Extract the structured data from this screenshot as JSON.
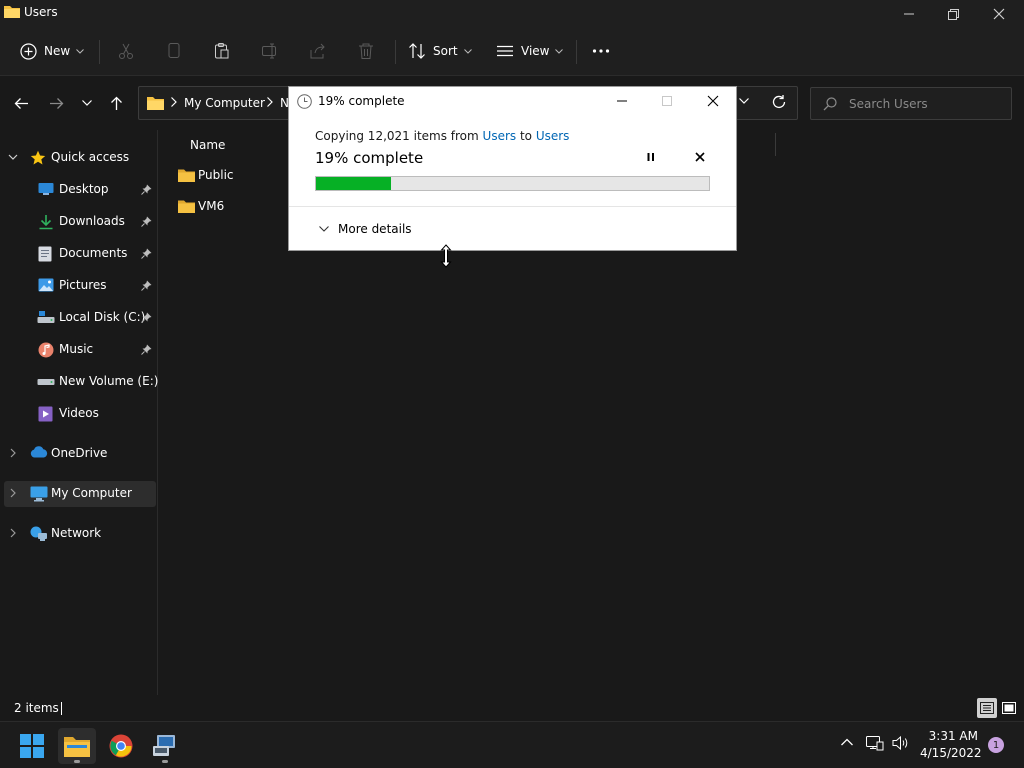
{
  "window": {
    "title": "Users"
  },
  "toolbar": {
    "new_label": "New",
    "sort_label": "Sort",
    "view_label": "View"
  },
  "address": {
    "crumb1": "My Computer",
    "crumb2": "N"
  },
  "search": {
    "placeholder": "Search Users"
  },
  "sidebar": {
    "items": [
      {
        "label": "Quick access",
        "icon": "star-icon"
      },
      {
        "label": "Desktop",
        "icon": "desktop-icon"
      },
      {
        "label": "Downloads",
        "icon": "download-icon"
      },
      {
        "label": "Documents",
        "icon": "document-icon"
      },
      {
        "label": "Pictures",
        "icon": "picture-icon"
      },
      {
        "label": "Local Disk (C:)",
        "icon": "drive-icon"
      },
      {
        "label": "Music",
        "icon": "music-icon"
      },
      {
        "label": "New Volume (E:)",
        "icon": "drive-icon"
      },
      {
        "label": "Videos",
        "icon": "video-icon"
      },
      {
        "label": "OneDrive",
        "icon": "cloud-icon"
      },
      {
        "label": "My Computer",
        "icon": "computer-icon"
      },
      {
        "label": "Network",
        "icon": "network-icon"
      }
    ]
  },
  "content": {
    "column_name": "Name",
    "files": [
      {
        "name": "Public"
      },
      {
        "name": "VM6"
      }
    ]
  },
  "status": {
    "item_count": "2 items"
  },
  "taskbar": {
    "time": "3:31 AM",
    "date": "4/15/2022",
    "notifications": "1"
  },
  "dialog": {
    "title": "19% complete",
    "copy_prefix": "Copying 12,021 items from ",
    "from": "Users",
    "to_word": " to ",
    "to": "Users",
    "percent_text": "19% complete",
    "progress": 0.19,
    "more_details": "More details"
  },
  "colors": {
    "progress_fill": "#06b025",
    "link": "#0066b4",
    "folder": "#f5c142"
  }
}
